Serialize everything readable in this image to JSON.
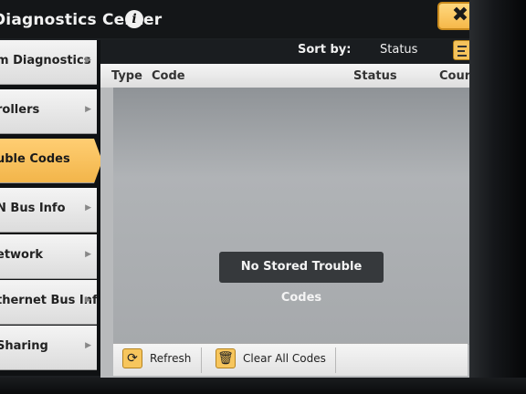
{
  "window": {
    "title": "Diagnostics Center",
    "info_icon": "info-icon",
    "close_icon": "close-icon",
    "close_label": "✖"
  },
  "sidebar": {
    "items": [
      {
        "label": "m Diagnostics",
        "active": false
      },
      {
        "label": "rollers",
        "active": false
      },
      {
        "label": "uble Codes",
        "active": true
      },
      {
        "label": "N Bus Info",
        "active": false
      },
      {
        "label": "etwork",
        "active": false
      },
      {
        "label": "thernet Bus Info",
        "active": false
      },
      {
        "label": "Sharing",
        "active": false
      }
    ]
  },
  "sort": {
    "label": "Sort by:",
    "value": "Status",
    "icon": "sort-list-icon"
  },
  "columns": {
    "type": "Type",
    "code": "Code",
    "status": "Status",
    "count": "Count"
  },
  "empty_message": "No Stored Trouble Codes",
  "footer": {
    "refresh_label": "Refresh",
    "refresh_icon": "refresh-icon",
    "clear_label": "Clear All Codes",
    "clear_icon": "trash-icon"
  },
  "colors": {
    "accent": "#f6b84a",
    "titlebar": "#141618",
    "list_bg": "#a6a9ac"
  }
}
